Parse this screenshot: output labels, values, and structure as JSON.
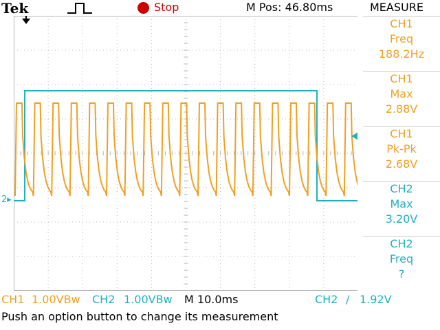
{
  "colors": {
    "ch1": "#f0a020",
    "ch2": "#20b0c0",
    "stop": "#cc0000",
    "grid": "#b8b8b8"
  },
  "top_bar": {
    "brand": "Tek",
    "trigger_icon": "rising-edge-pulse-icon",
    "acq_state": "Stop",
    "m_pos": "M Pos: 46.80ms",
    "panel_title": "MEASURE"
  },
  "measurements": [
    {
      "source": "CH1",
      "type": "Freq",
      "value": "188.2Hz",
      "channel": "ch1"
    },
    {
      "source": "CH1",
      "type": "Max",
      "value": "2.88V",
      "channel": "ch1"
    },
    {
      "source": "CH1",
      "type": "Pk-Pk",
      "value": "2.68V",
      "channel": "ch1"
    },
    {
      "source": "CH2",
      "type": "Max",
      "value": "3.20V",
      "channel": "ch2"
    },
    {
      "source": "CH2",
      "type": "Freq",
      "value": "?",
      "channel": "ch2"
    }
  ],
  "status": {
    "ch1_label": "CH1",
    "ch1_scale": "1.00VBw",
    "ch2_label": "CH2",
    "ch2_scale": "1.00VBw",
    "timebase": "M 10.0ms",
    "trigger_src": "CH2",
    "trigger_slope": "/",
    "trigger_level": "1.92V"
  },
  "message": "Push an option button to change its measurement",
  "markers": {
    "ch2_ground": "2"
  }
}
